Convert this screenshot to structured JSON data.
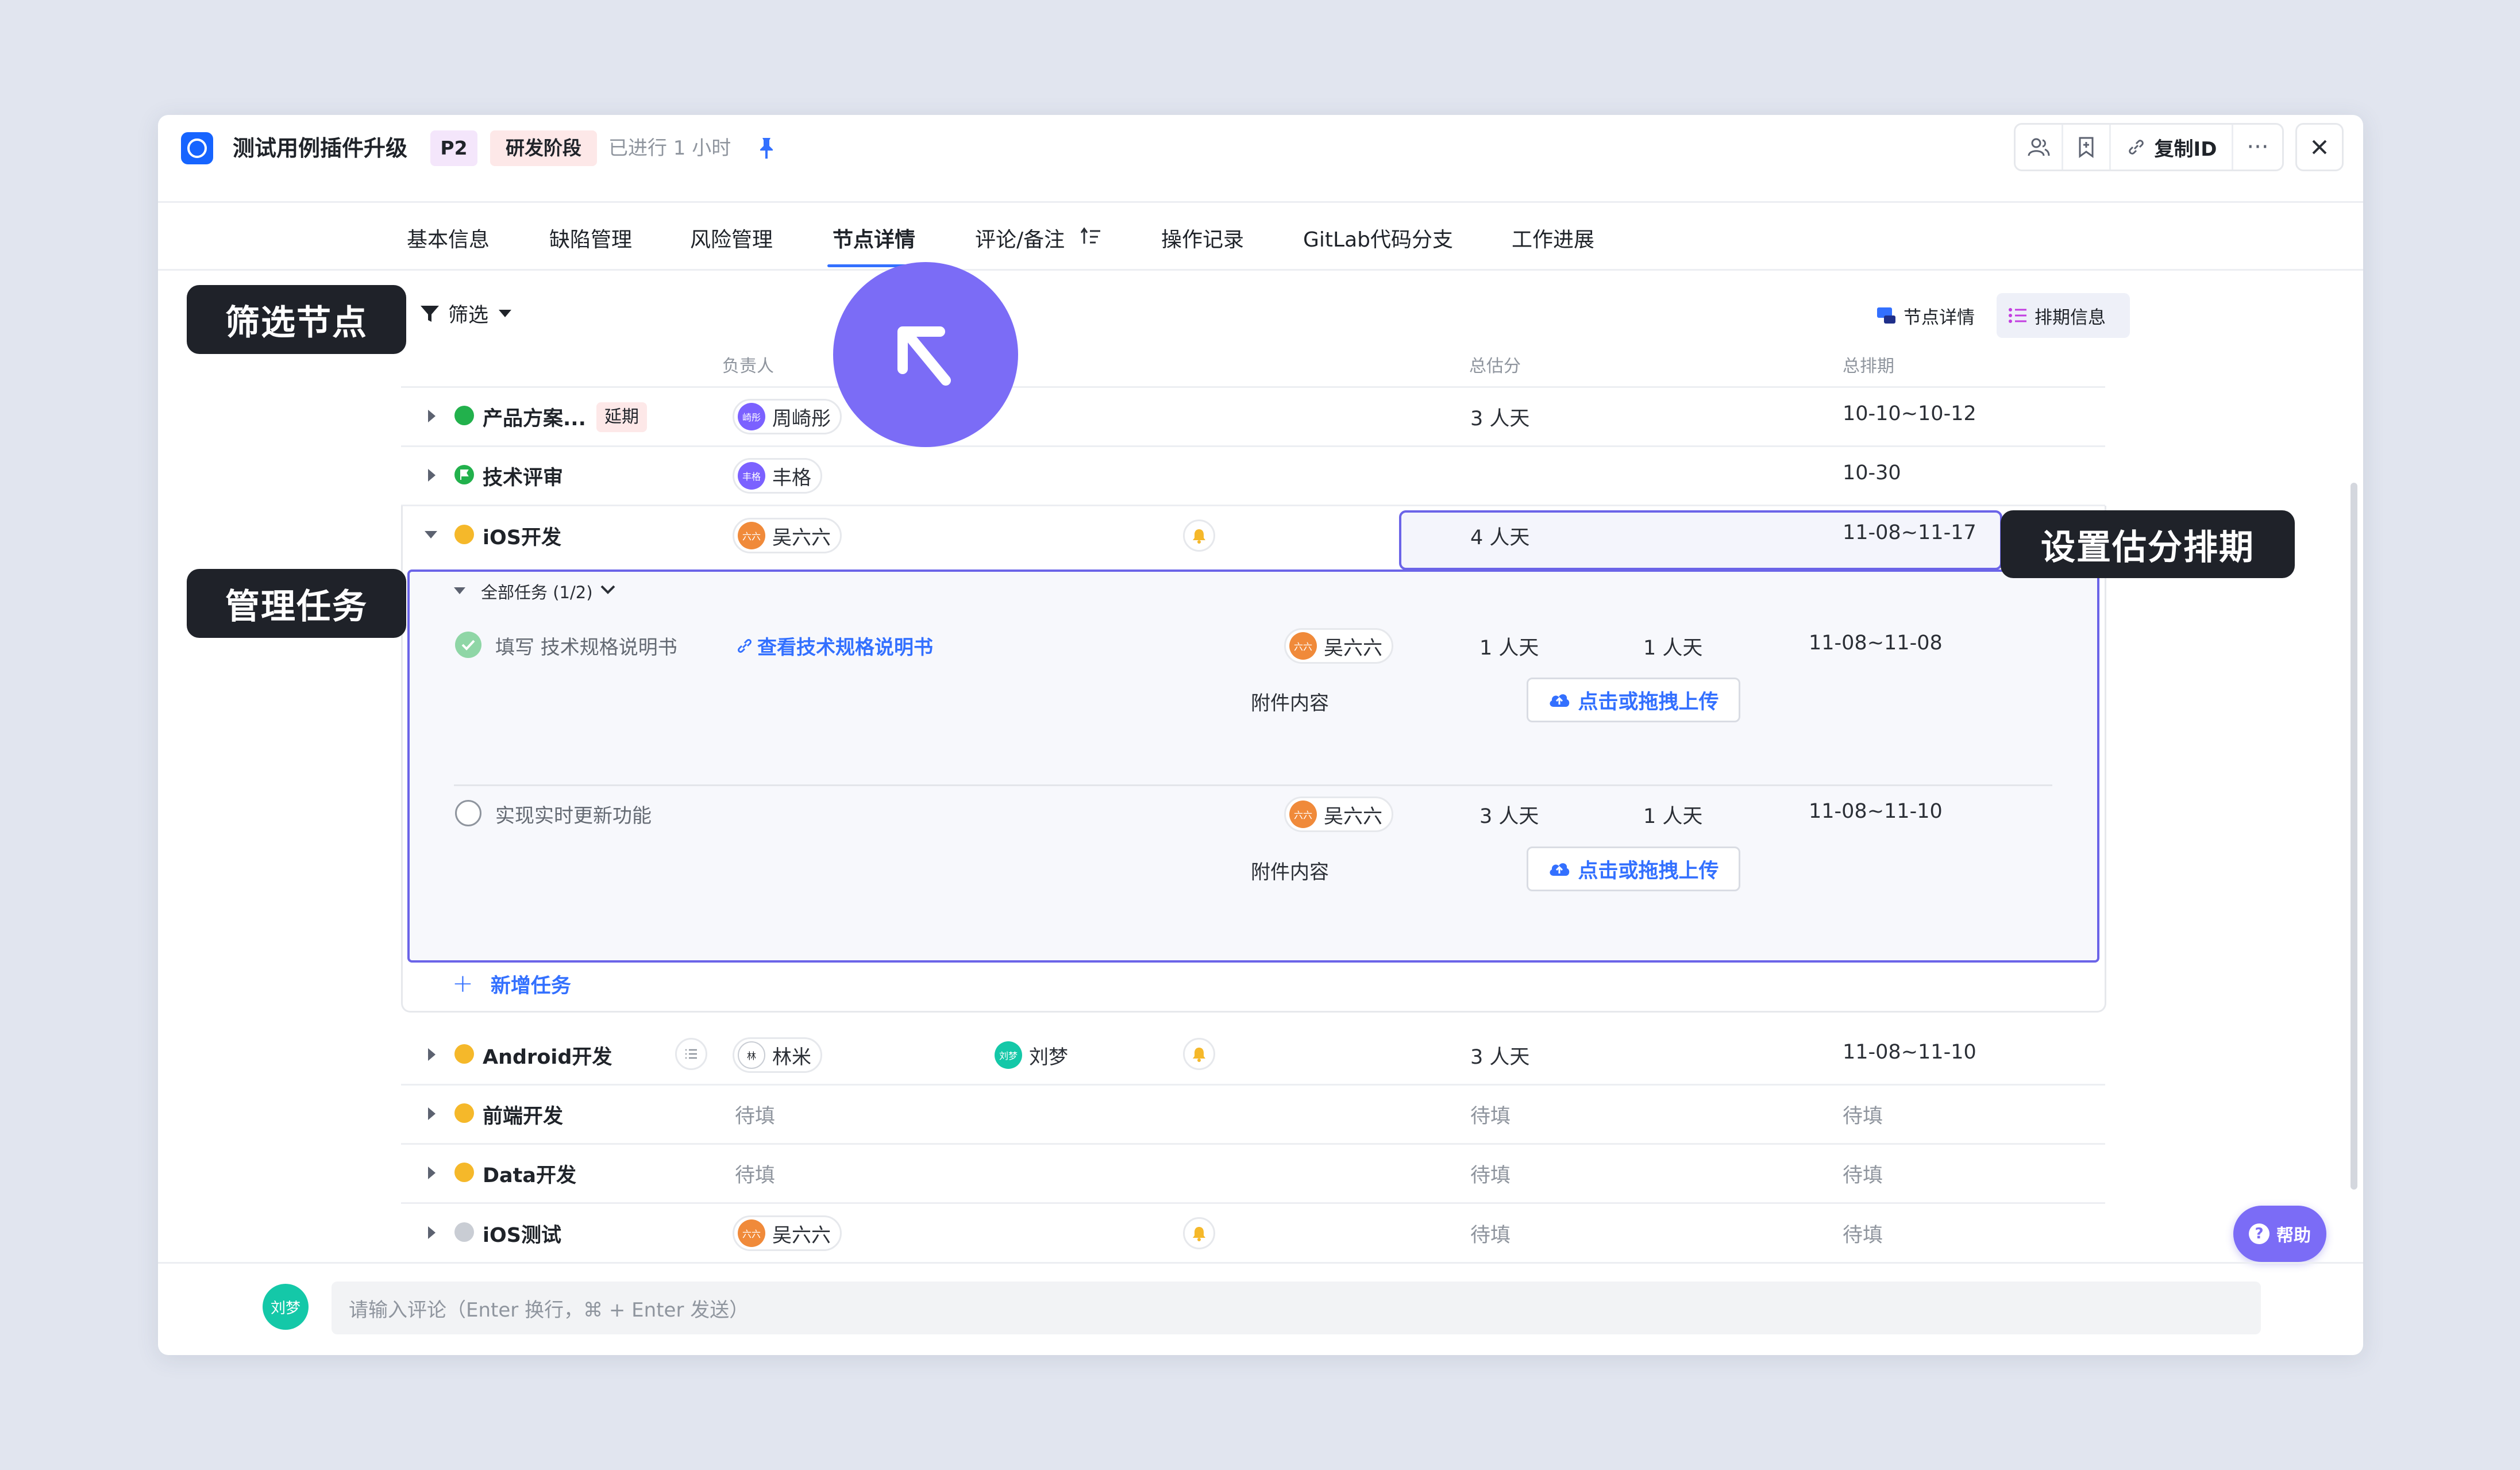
{
  "header": {
    "title": "测试用例插件升级",
    "priority": "P2",
    "stage": "研发阶段",
    "elapsed": "已进行 1 小时",
    "copy_id_label": "复制ID"
  },
  "tabs": [
    "基本信息",
    "缺陷管理",
    "风险管理",
    "节点详情",
    "评论/备注",
    "操作记录",
    "GitLab代码分支",
    "工作进展"
  ],
  "active_tab": "节点详情",
  "toolbar": {
    "filter_label": "筛选",
    "view_node_detail": "节点详情",
    "view_schedule": "排期信息"
  },
  "columns": {
    "owner": "负责人",
    "total_estimate": "总估分",
    "total_schedule": "总排期"
  },
  "rows": [
    {
      "name": "产品方案...",
      "status_color": "#22b14c",
      "badge": "延期",
      "owners": [
        {
          "avatar": "崎彤",
          "name": "周崎彤",
          "color": "#7b61ff"
        }
      ],
      "estimate": "3 人天",
      "schedule": "10-10~10-12"
    },
    {
      "name": "技术评审",
      "status_color": "#22b14c",
      "owners": [
        {
          "avatar": "丰格",
          "name": "丰格",
          "color": "#7b61ff"
        }
      ],
      "estimate": "",
      "schedule": "10-30"
    },
    {
      "name": "iOS开发",
      "status_color": "#f5b82a",
      "owners": [
        {
          "avatar": "六六",
          "name": "吴六六",
          "color": "#f08a3a"
        }
      ],
      "estimate": "4 人天",
      "schedule": "11-08~11-17"
    }
  ],
  "subtasks": {
    "header": "全部任务 (1/2)",
    "items": [
      {
        "title": "填写 技术规格说明书",
        "done": true,
        "link": "查看技术规格说明书",
        "owner": "吴六六",
        "avatar": "六六",
        "est1": "1 人天",
        "est2": "1 人天",
        "schedule": "11-08~11-08",
        "attachment_label": "附件内容",
        "upload_label": "点击或拖拽上传"
      },
      {
        "title": "实现实时更新功能",
        "done": false,
        "owner": "吴六六",
        "avatar": "六六",
        "est1": "3 人天",
        "est2": "1 人天",
        "schedule": "11-08~11-10",
        "attachment_label": "附件内容",
        "upload_label": "点击或拖拽上传"
      }
    ],
    "add_label": "新增任务"
  },
  "rows_after": [
    {
      "name": "Android开发",
      "status_color": "#f5b82a",
      "owners": [
        {
          "avatar": "林",
          "name": "林米",
          "color": "#ffffff"
        },
        {
          "avatar": "刘梦",
          "name": "刘梦",
          "color": "#14c8a8"
        }
      ],
      "estimate": "3 人天",
      "schedule": "11-08~11-10"
    },
    {
      "name": "前端开发",
      "status_color": "#f5b82a",
      "owner_placeholder": "待填",
      "estimate": "待填",
      "schedule": "待填"
    },
    {
      "name": "Data开发",
      "status_color": "#f5b82a",
      "owner_placeholder": "待填",
      "estimate": "待填",
      "schedule": "待填"
    },
    {
      "name": "iOS测试",
      "status_color": "#c9cdd4",
      "owners": [
        {
          "avatar": "六六",
          "name": "吴六六",
          "color": "#f08a3a"
        }
      ],
      "estimate": "待填",
      "schedule": "待填"
    }
  ],
  "comment": {
    "avatar": "刘梦",
    "placeholder": "请输入评论（Enter 换行，⌘ + Enter 发送）"
  },
  "help_label": "帮助",
  "callouts": {
    "filter": "筛选节点",
    "tasks": "管理任务",
    "estimate": "设置估分排期"
  },
  "colors": {
    "accent": "#3370ff",
    "purple": "#7b6cf6",
    "callout_bg": "#1f2229"
  }
}
